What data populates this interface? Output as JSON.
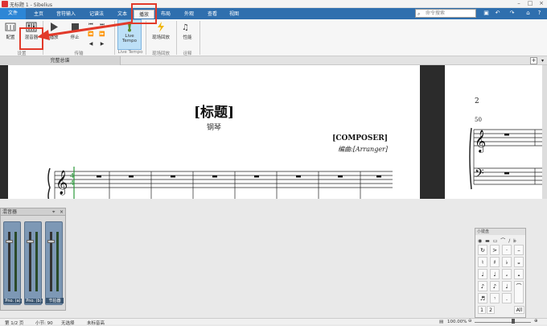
{
  "window": {
    "title": "无标题 1 - Sibelius"
  },
  "menu": {
    "tabs": [
      "文件",
      "主页",
      "音符输入",
      "记谱法",
      "文本",
      "播放",
      "布局",
      "外观",
      "查看",
      "视图"
    ],
    "active_tab": "播放",
    "search_placeholder": "命令搜索"
  },
  "ribbon": {
    "buttons": {
      "setup": "配置",
      "mixer": "混音器",
      "play": "播放",
      "stop": "停止",
      "live_tempo_line1": "Live",
      "live_tempo_line2": "Tempo",
      "live_playback": "现场回放",
      "performance": "性能"
    },
    "groups": {
      "setup": "设置",
      "transport": "传输",
      "live_tempo": "Live Tempo",
      "live_playback": "现场回放",
      "interpretation": "诠释"
    }
  },
  "score_tab": {
    "label": "完整总谱"
  },
  "score": {
    "title": "[标题]",
    "subtitle": "钢琴",
    "composer": "[COMPOSER]",
    "arranger": "编曲:[Arranger]",
    "page2_number": "2",
    "page2_bar": "50"
  },
  "mixer": {
    "title": "混音器",
    "strips": [
      "Pno. (a)",
      "Pno. (b)",
      "节拍器"
    ]
  },
  "keypad": {
    "title": "小键盘",
    "rows": [
      [
        "↻",
        ">",
        "·",
        "–"
      ],
      [
        "♮",
        "♯",
        "♭",
        "𝄪"
      ],
      [
        "♩",
        "♩",
        "𝅗",
        "𝅝"
      ],
      [
        "♪",
        "♪",
        "♩",
        "⌒"
      ],
      [
        "♬",
        "𝄾",
        ".",
        ""
      ]
    ],
    "footer": [
      "1",
      "2",
      "All"
    ]
  },
  "status": {
    "page": "第 1/2 页",
    "bar": "小节: 90",
    "selection": "无选择",
    "pitch": "未标音高",
    "zoom": "100.00%"
  },
  "colors": {
    "menubar": "#2f6fae",
    "file_tab": "#2d86d6",
    "annotation": "#e23a2a",
    "mixer_strip": "#7d98b5"
  }
}
